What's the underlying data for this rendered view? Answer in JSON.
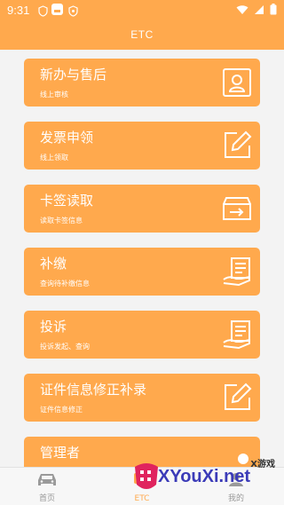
{
  "status_bar": {
    "time": "9:31"
  },
  "header": {
    "title": "ETC"
  },
  "cards": [
    {
      "title": "新办与售后",
      "subtitle": "线上审核",
      "icon": "id-card-icon"
    },
    {
      "title": "发票申领",
      "subtitle": "线上领取",
      "icon": "edit-icon"
    },
    {
      "title": "卡签读取",
      "subtitle": "读取卡签信息",
      "icon": "card-read-icon"
    },
    {
      "title": "补缴",
      "subtitle": "查询待补缴信息",
      "icon": "bill-hand-icon"
    },
    {
      "title": "投诉",
      "subtitle": "投诉发起、查询",
      "icon": "bill-hand-icon"
    },
    {
      "title": "证件信息修正补录",
      "subtitle": "证件信息修正",
      "icon": "edit-icon"
    },
    {
      "title": "管理者",
      "subtitle": "",
      "icon": "toggle-icon"
    }
  ],
  "bottom_nav": {
    "items": [
      {
        "label": "首页",
        "icon": "car-icon",
        "active": false
      },
      {
        "label": "ETC",
        "icon": "etc-icon",
        "active": true
      },
      {
        "label": "我的",
        "icon": "user-icon",
        "active": false
      }
    ]
  },
  "watermark": {
    "top_text": "X游戏",
    "main_text": "XYouXi.net"
  },
  "colors": {
    "accent": "#ffa94d",
    "background": "#f3f3f3",
    "nav_background": "#f7f7f7"
  }
}
